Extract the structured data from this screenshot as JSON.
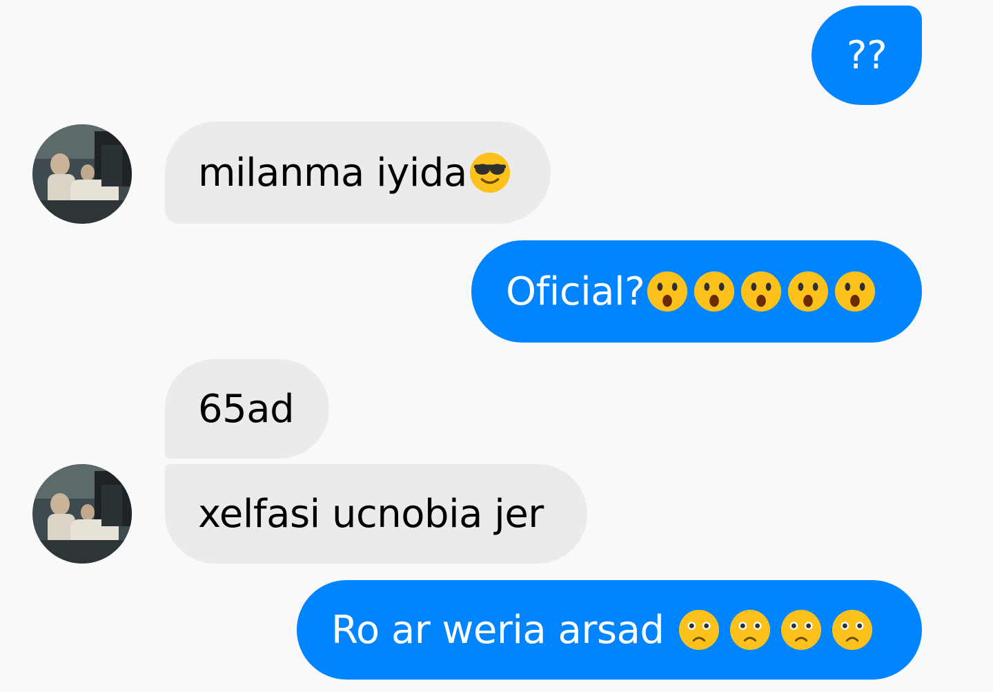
{
  "messages": [
    {
      "id": "m1",
      "direction": "outgoing",
      "text": "??",
      "emojis": []
    },
    {
      "id": "m2",
      "direction": "incoming",
      "text": "milanma iyida",
      "emojis": [
        "sunglasses-emoji"
      ]
    },
    {
      "id": "m3",
      "direction": "outgoing",
      "text": "Oficial?",
      "emojis": [
        "astonished-emoji",
        "astonished-emoji",
        "astonished-emoji",
        "astonished-emoji",
        "astonished-emoji"
      ]
    },
    {
      "id": "m4",
      "direction": "incoming",
      "text": "65ad",
      "emojis": []
    },
    {
      "id": "m5",
      "direction": "incoming",
      "text": "xelfasi ucnobia jer",
      "emojis": []
    },
    {
      "id": "m6",
      "direction": "outgoing",
      "text": "Ro ar weria arsad ",
      "emojis": [
        "frowning-emoji",
        "frowning-emoji",
        "frowning-emoji",
        "frowning-emoji"
      ]
    }
  ],
  "colors": {
    "outgoing_bubble": "#0084ff",
    "incoming_bubble": "#ebebeb",
    "background": "#f9f9f9"
  },
  "avatar": {
    "icon": "contact-avatar"
  }
}
